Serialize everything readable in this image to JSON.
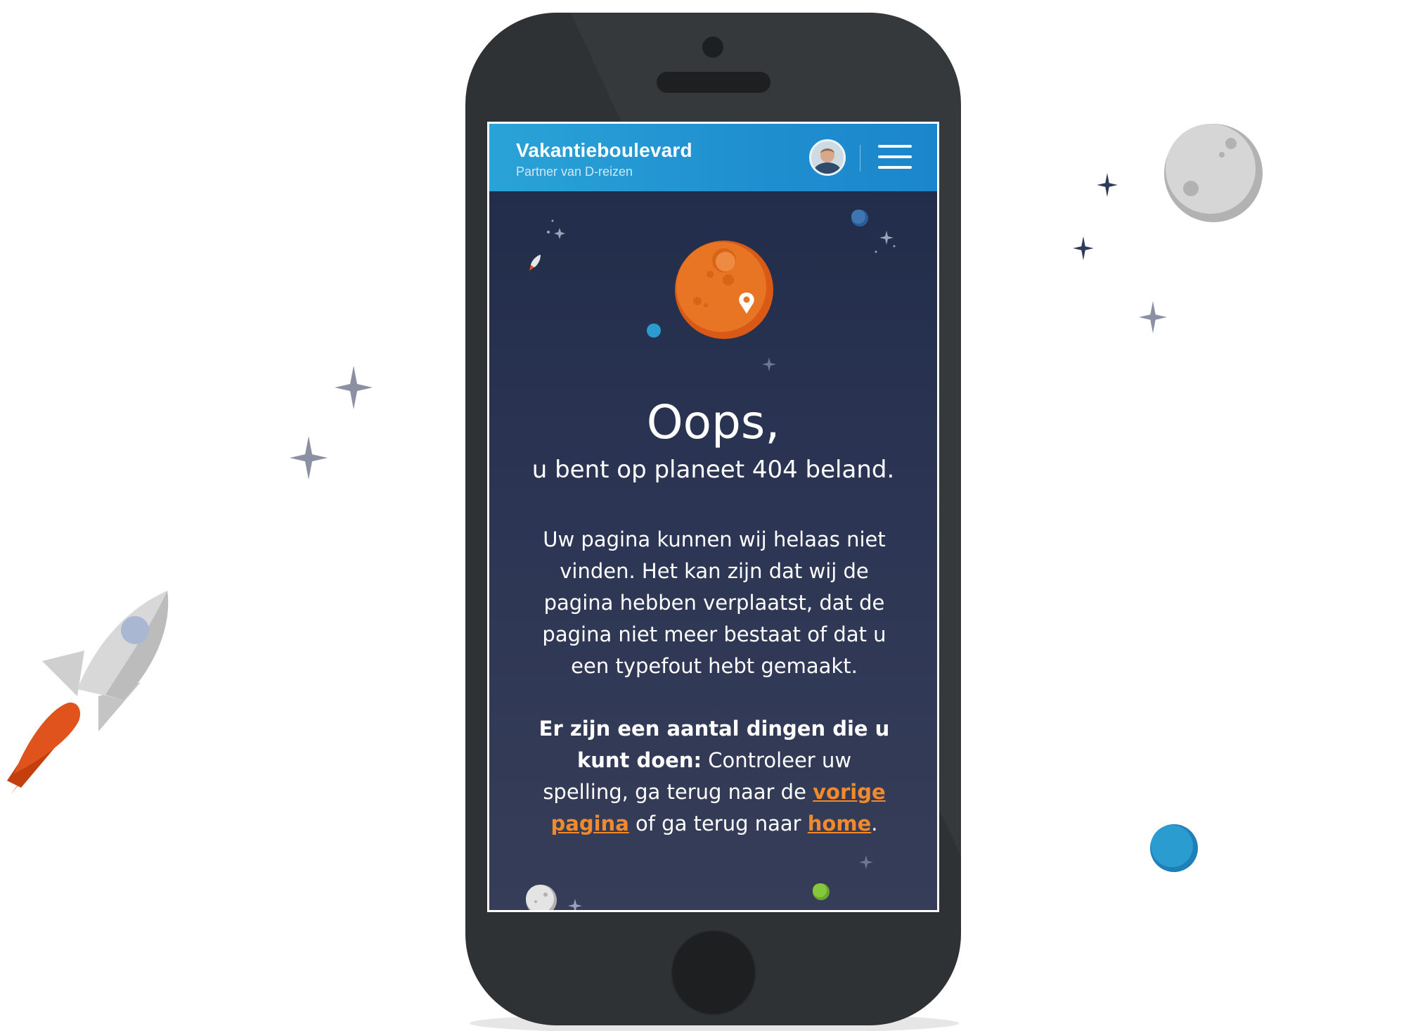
{
  "header": {
    "brand_name": "Vakantieboulevard",
    "brand_subtitle": "Partner van D-reizen"
  },
  "error": {
    "title": "Oops,",
    "subtitle": "u bent op planeet 404 beland.",
    "description": "Uw pagina kunnen wij helaas niet vinden. Het kan zijn dat wij de pagina hebben verplaatst, dat de pagina niet meer bestaat of dat u een typefout hebt gemaakt.",
    "suggestion_lead": "Er zijn een aantal dingen die u kunt doen:",
    "suggestion_text_1": " Controleer uw spelling, ga terug naar de ",
    "link_previous": "vorige pagina",
    "suggestion_text_2": " of ga terug naar ",
    "link_home": "home",
    "suggestion_end": "."
  },
  "icons": {
    "menu": "hamburger-menu-icon",
    "avatar": "user-avatar",
    "planet": "orange-planet-with-location-pin"
  },
  "colors": {
    "header_gradient_start": "#2aa3d7",
    "header_gradient_end": "#1b86cc",
    "screen_background": "#2b3553",
    "link": "#f08a2c",
    "phone_body": "#2f3234"
  }
}
